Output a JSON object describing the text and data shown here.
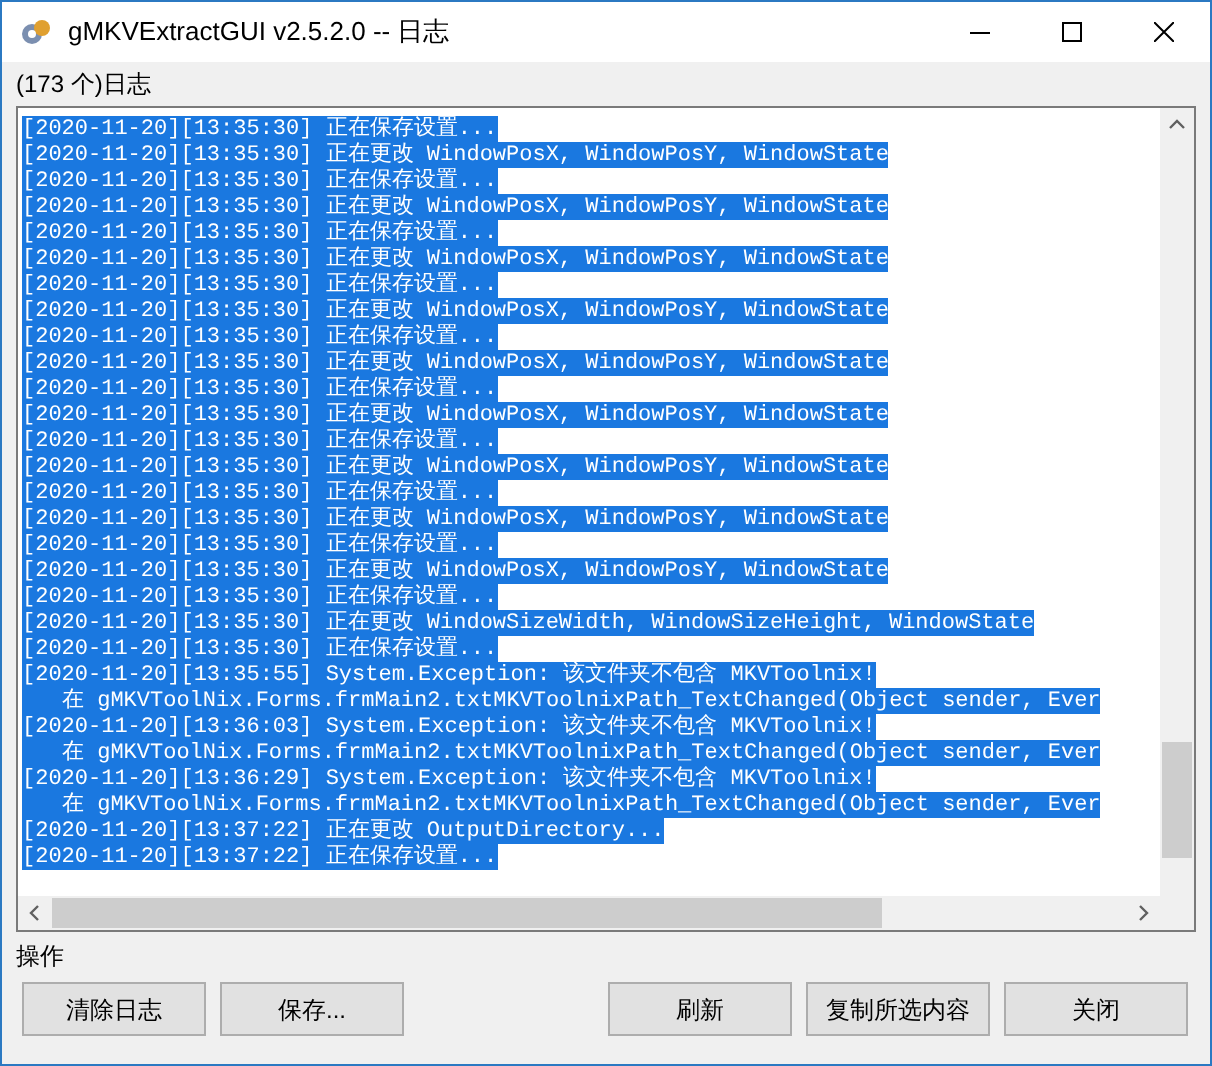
{
  "window": {
    "title": "gMKVExtractGUI v2.5.2.0 -- 日志"
  },
  "log": {
    "label": "(173 个)日志",
    "lines": [
      {
        "kind": "entry",
        "text": "[2020-11-20][13:35:30] 正在保存设置...",
        "selected": true
      },
      {
        "kind": "entry",
        "text": "[2020-11-20][13:35:30] 正在更改 WindowPosX, WindowPosY, WindowState",
        "selected": true
      },
      {
        "kind": "entry",
        "text": "[2020-11-20][13:35:30] 正在保存设置...",
        "selected": true
      },
      {
        "kind": "entry",
        "text": "[2020-11-20][13:35:30] 正在更改 WindowPosX, WindowPosY, WindowState",
        "selected": true
      },
      {
        "kind": "entry",
        "text": "[2020-11-20][13:35:30] 正在保存设置...",
        "selected": true
      },
      {
        "kind": "entry",
        "text": "[2020-11-20][13:35:30] 正在更改 WindowPosX, WindowPosY, WindowState",
        "selected": true
      },
      {
        "kind": "entry",
        "text": "[2020-11-20][13:35:30] 正在保存设置...",
        "selected": true
      },
      {
        "kind": "entry",
        "text": "[2020-11-20][13:35:30] 正在更改 WindowPosX, WindowPosY, WindowState",
        "selected": true
      },
      {
        "kind": "entry",
        "text": "[2020-11-20][13:35:30] 正在保存设置...",
        "selected": true
      },
      {
        "kind": "entry",
        "text": "[2020-11-20][13:35:30] 正在更改 WindowPosX, WindowPosY, WindowState",
        "selected": true
      },
      {
        "kind": "entry",
        "text": "[2020-11-20][13:35:30] 正在保存设置...",
        "selected": true
      },
      {
        "kind": "entry",
        "text": "[2020-11-20][13:35:30] 正在更改 WindowPosX, WindowPosY, WindowState",
        "selected": true
      },
      {
        "kind": "entry",
        "text": "[2020-11-20][13:35:30] 正在保存设置...",
        "selected": true
      },
      {
        "kind": "entry",
        "text": "[2020-11-20][13:35:30] 正在更改 WindowPosX, WindowPosY, WindowState",
        "selected": true
      },
      {
        "kind": "entry",
        "text": "[2020-11-20][13:35:30] 正在保存设置...",
        "selected": true
      },
      {
        "kind": "entry",
        "text": "[2020-11-20][13:35:30] 正在更改 WindowPosX, WindowPosY, WindowState",
        "selected": true
      },
      {
        "kind": "entry",
        "text": "[2020-11-20][13:35:30] 正在保存设置...",
        "selected": true
      },
      {
        "kind": "entry",
        "text": "[2020-11-20][13:35:30] 正在更改 WindowPosX, WindowPosY, WindowState",
        "selected": true
      },
      {
        "kind": "entry",
        "text": "[2020-11-20][13:35:30] 正在保存设置...",
        "selected": true
      },
      {
        "kind": "entry",
        "text": "[2020-11-20][13:35:30] 正在更改 WindowSizeWidth, WindowSizeHeight, WindowState",
        "selected": true
      },
      {
        "kind": "entry",
        "text": "[2020-11-20][13:35:30] 正在保存设置...",
        "selected": true
      },
      {
        "kind": "entry",
        "text": "[2020-11-20][13:35:55] System.Exception: 该文件夹不包含 MKVToolnix!",
        "selected": true
      },
      {
        "kind": "trace",
        "text": "在 gMKVToolNix.Forms.frmMain2.txtMKVToolnixPath_TextChanged(Object sender, Ever",
        "selected": true
      },
      {
        "kind": "entry",
        "text": "[2020-11-20][13:36:03] System.Exception: 该文件夹不包含 MKVToolnix!",
        "selected": true
      },
      {
        "kind": "trace",
        "text": "在 gMKVToolNix.Forms.frmMain2.txtMKVToolnixPath_TextChanged(Object sender, Ever",
        "selected": true
      },
      {
        "kind": "entry",
        "text": "[2020-11-20][13:36:29] System.Exception: 该文件夹不包含 MKVToolnix!",
        "selected": true
      },
      {
        "kind": "trace",
        "text": "在 gMKVToolNix.Forms.frmMain2.txtMKVToolnixPath_TextChanged(Object sender, Ever",
        "selected": true
      },
      {
        "kind": "entry",
        "text": "[2020-11-20][13:37:22] 正在更改 OutputDirectory...",
        "selected": true
      },
      {
        "kind": "entry",
        "text": "[2020-11-20][13:37:22] 正在保存设置...",
        "selected": true
      }
    ]
  },
  "actions": {
    "label": "操作",
    "buttons": [
      {
        "kind": "left",
        "label": "清除日志"
      },
      {
        "kind": "left",
        "label": "保存..."
      },
      {
        "kind": "right",
        "label": "刷新"
      },
      {
        "kind": "right",
        "label": "复制所选内容"
      },
      {
        "kind": "right",
        "label": "关闭"
      }
    ]
  }
}
